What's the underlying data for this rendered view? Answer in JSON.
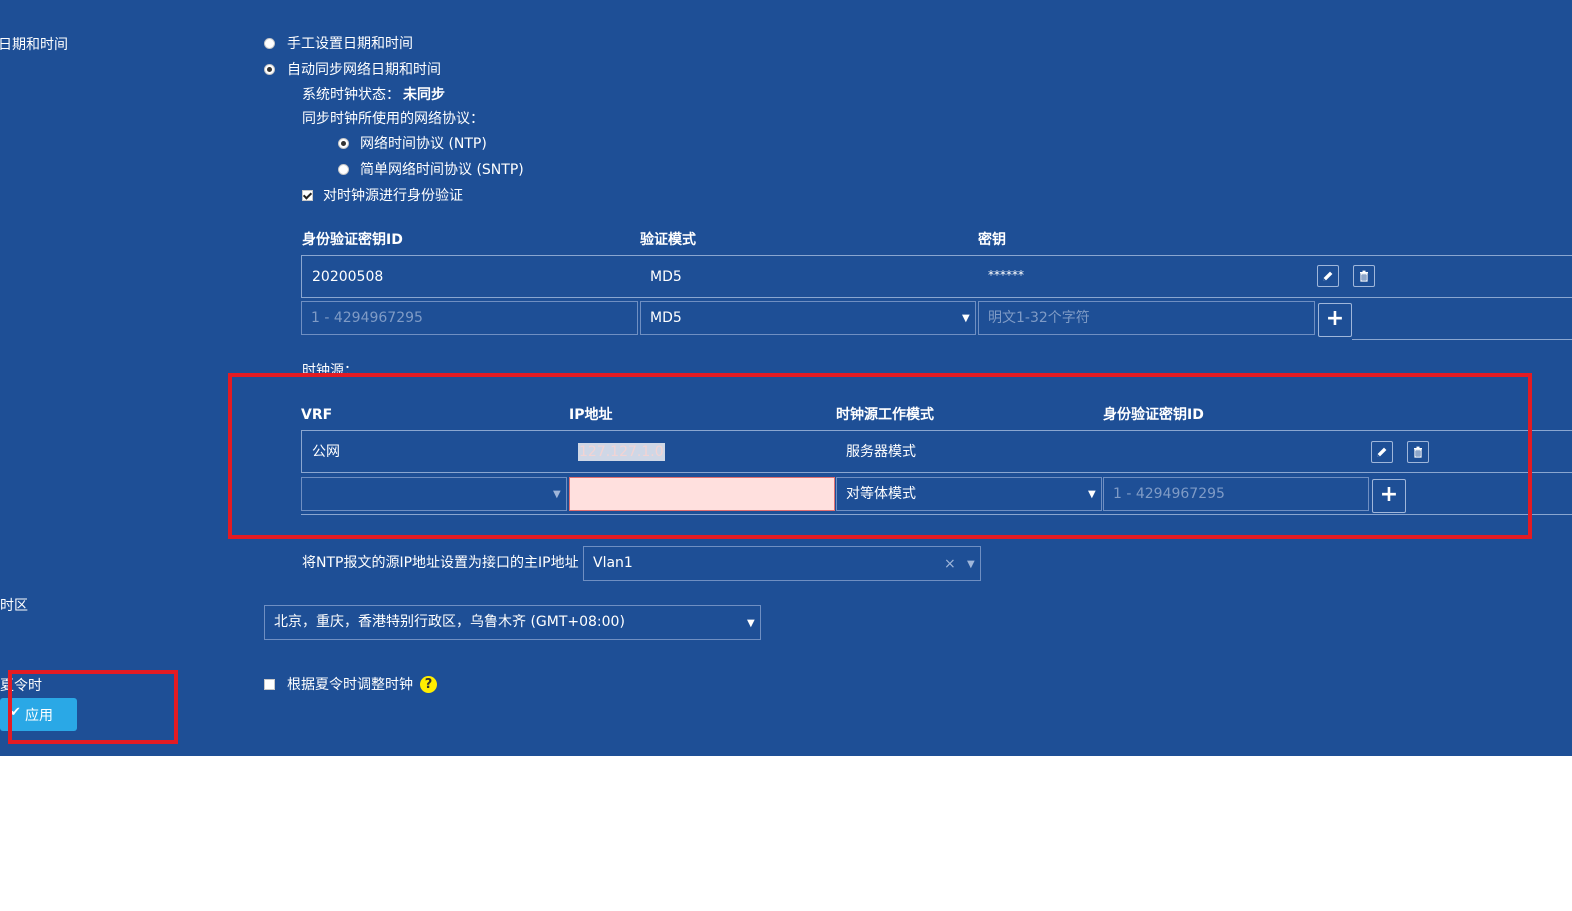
{
  "datetime": {
    "section_label": "日期和时间",
    "manual_option": "手工设置日期和时间",
    "auto_option": "自动同步网络日期和时间",
    "status_label": "系统时钟状态：",
    "status_value": "未同步",
    "protocol_label": "同步时钟所使用的网络协议：",
    "ntp_option": "网络时间协议 (NTP)",
    "sntp_option": "简单网络时间协议 (SNTP)",
    "auth_checkbox": "对时钟源进行身份验证"
  },
  "auth_table": {
    "headers": [
      "身份验证密钥ID",
      "验证模式",
      "密钥"
    ],
    "rows": [
      {
        "key_id": "20200508",
        "mode": "MD5",
        "key": "******"
      }
    ],
    "new_row": {
      "key_id_placeholder": "1 - 4294967295",
      "mode_value": "MD5",
      "key_placeholder": "明文1-32个字符"
    }
  },
  "clock_source": {
    "label": "时钟源：",
    "headers": [
      "VRF",
      "IP地址",
      "时钟源工作模式",
      "身份验证密钥ID"
    ],
    "rows": [
      {
        "vrf": "公网",
        "ip": "127.127.1.0",
        "mode": "服务器模式",
        "key_id": ""
      }
    ],
    "new_row": {
      "vrf_value": "",
      "ip_value": "",
      "mode_value": "对等体模式",
      "key_id_placeholder": "1 - 4294967295"
    }
  },
  "source_ip": {
    "label": "将NTP报文的源IP地址设置为接口的主IP地址",
    "value": "Vlan1",
    "clear_glyph": "×"
  },
  "timezone": {
    "section_label": "时区",
    "value": "北京，重庆，香港特别行政区，乌鲁木齐 (GMT+08:00)"
  },
  "dst": {
    "section_label": "夏令时",
    "checkbox_label": "根据夏令时调整时钟",
    "help_glyph": "?"
  },
  "apply_button": {
    "label": "应用",
    "icon_glyph": "✔"
  },
  "colors": {
    "panel_background": "#1e4f96",
    "highlight_border": "#e31b23",
    "apply_button": "#2aa8e6",
    "invalid_field": "#ffe0de",
    "help_icon": "#ffee00"
  }
}
